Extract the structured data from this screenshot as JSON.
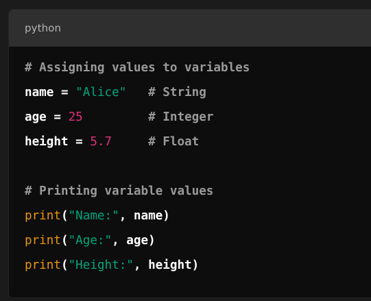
{
  "header": {
    "language": "python"
  },
  "colors": {
    "background": "#0d0d0d",
    "header_background": "#2f2f2f",
    "comment": "#9a9a9a",
    "string": "#00a67d",
    "number": "#df3079",
    "builtin": "#e9950c",
    "identifier": "#ffffff"
  },
  "code": {
    "lines": [
      [
        {
          "t": "# Assigning values to variables",
          "k": "comment"
        }
      ],
      [
        {
          "t": "name",
          "k": "ident"
        },
        {
          "t": " = ",
          "k": "op"
        },
        {
          "t": "\"Alice\"",
          "k": "string"
        },
        {
          "t": "   ",
          "k": "op"
        },
        {
          "t": "# String",
          "k": "comment"
        }
      ],
      [
        {
          "t": "age",
          "k": "ident"
        },
        {
          "t": " = ",
          "k": "op"
        },
        {
          "t": "25",
          "k": "number"
        },
        {
          "t": "         ",
          "k": "op"
        },
        {
          "t": "# Integer",
          "k": "comment"
        }
      ],
      [
        {
          "t": "height",
          "k": "ident"
        },
        {
          "t": " = ",
          "k": "op"
        },
        {
          "t": "5.7",
          "k": "number"
        },
        {
          "t": "     ",
          "k": "op"
        },
        {
          "t": "# Float",
          "k": "comment"
        }
      ],
      [],
      [
        {
          "t": "# Printing variable values",
          "k": "comment"
        }
      ],
      [
        {
          "t": "print",
          "k": "builtin"
        },
        {
          "t": "(",
          "k": "punct"
        },
        {
          "t": "\"Name:\"",
          "k": "string"
        },
        {
          "t": ", name)",
          "k": "punct"
        }
      ],
      [
        {
          "t": "print",
          "k": "builtin"
        },
        {
          "t": "(",
          "k": "punct"
        },
        {
          "t": "\"Age:\"",
          "k": "string"
        },
        {
          "t": ", age)",
          "k": "punct"
        }
      ],
      [
        {
          "t": "print",
          "k": "builtin"
        },
        {
          "t": "(",
          "k": "punct"
        },
        {
          "t": "\"Height:\"",
          "k": "string"
        },
        {
          "t": ", height)",
          "k": "punct"
        }
      ]
    ]
  }
}
